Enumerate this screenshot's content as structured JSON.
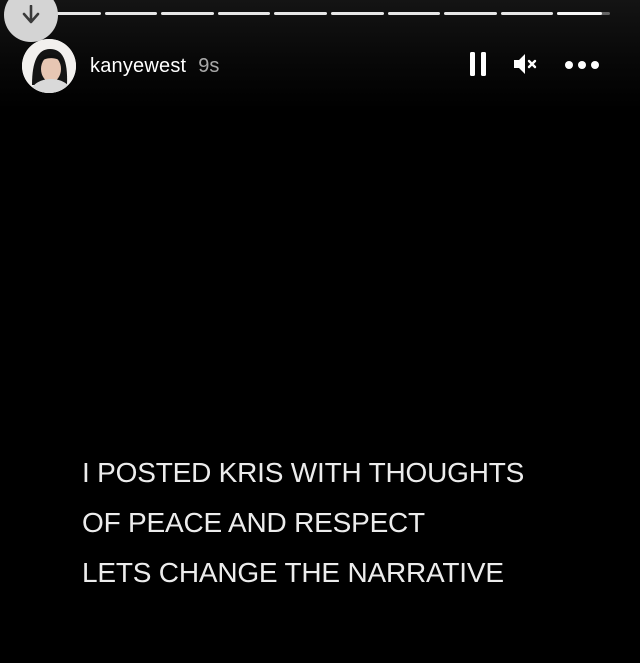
{
  "story": {
    "username": "kanyewest",
    "time_ago": "9s",
    "progress_segments": 10,
    "current_segment": 10,
    "current_segment_progress": 0.85
  },
  "icons": {
    "download": "arrow-down-icon",
    "pause": "pause-icon",
    "mute": "speaker-muted-icon",
    "more": "more-horizontal-icon"
  },
  "caption": {
    "lines": [
      "I POSTED KRIS WITH THOUGHTS",
      "OF PEACE AND RESPECT",
      "LETS CHANGE THE NARRATIVE"
    ]
  },
  "colors": {
    "background": "#000000",
    "text": "#ececec",
    "badge": "#d4d4d4"
  }
}
